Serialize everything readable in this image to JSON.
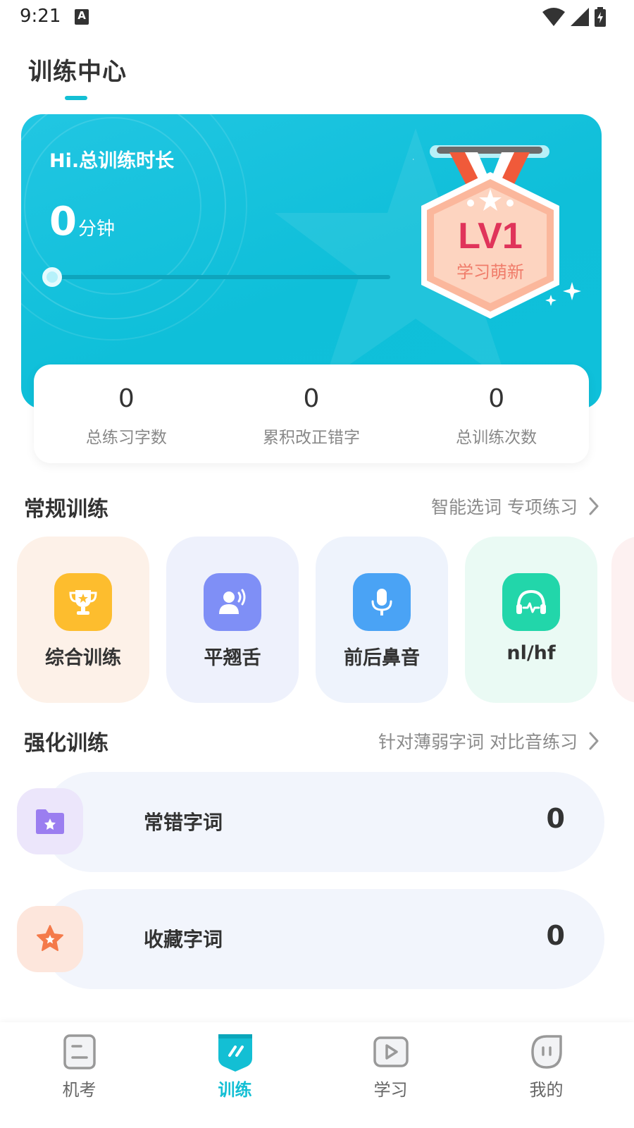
{
  "status_bar": {
    "time": "9:21",
    "notification_badge": "A"
  },
  "header": {
    "title": "训练中心"
  },
  "hero": {
    "greeting": "Hi.总训练时长",
    "minutes_value": "0",
    "minutes_unit": "分钟",
    "progress_fraction": 0,
    "medal": {
      "level": "LV1",
      "title": "学习萌新"
    }
  },
  "stats": [
    {
      "value": "0",
      "label": "总练习字数"
    },
    {
      "value": "0",
      "label": "累积改正错字"
    },
    {
      "value": "0",
      "label": "总训练次数"
    }
  ],
  "regular_training": {
    "title": "常规训练",
    "link": "智能选词 专项练习",
    "tiles": [
      {
        "label": "综合训练",
        "icon": "trophy-icon",
        "bg": "#fdf1e8",
        "icon_bg": "#fdbd2e"
      },
      {
        "label": "平翘舌",
        "icon": "speaker-person-icon",
        "bg": "#eef1fc",
        "icon_bg": "#7f8ff6"
      },
      {
        "label": "前后鼻音",
        "icon": "microphone-icon",
        "bg": "#eef3fc",
        "icon_bg": "#4aa3f5"
      },
      {
        "label": "nl/hf",
        "icon": "headphones-icon",
        "bg": "#eafaf4",
        "icon_bg": "#22d6aa"
      }
    ]
  },
  "strengthen_training": {
    "title": "强化训练",
    "link": "针对薄弱字词 对比音练习",
    "rows": [
      {
        "label": "常错字词",
        "count": "0",
        "icon": "star-folder-icon",
        "icon_bg": "#ece6fb",
        "icon_color": "#9b7ef0"
      },
      {
        "label": "收藏字词",
        "count": "0",
        "icon": "star-icon",
        "icon_bg": "#fde6dc",
        "icon_color": "#f47a4a"
      }
    ]
  },
  "bottom_nav": [
    {
      "label": "机考",
      "icon": "exam-icon"
    },
    {
      "label": "训练",
      "icon": "training-icon",
      "active": true
    },
    {
      "label": "学习",
      "icon": "play-icon"
    },
    {
      "label": "我的",
      "icon": "profile-icon"
    }
  ],
  "colors": {
    "accent": "#13bfd4",
    "medal_text": "#e0345a"
  }
}
